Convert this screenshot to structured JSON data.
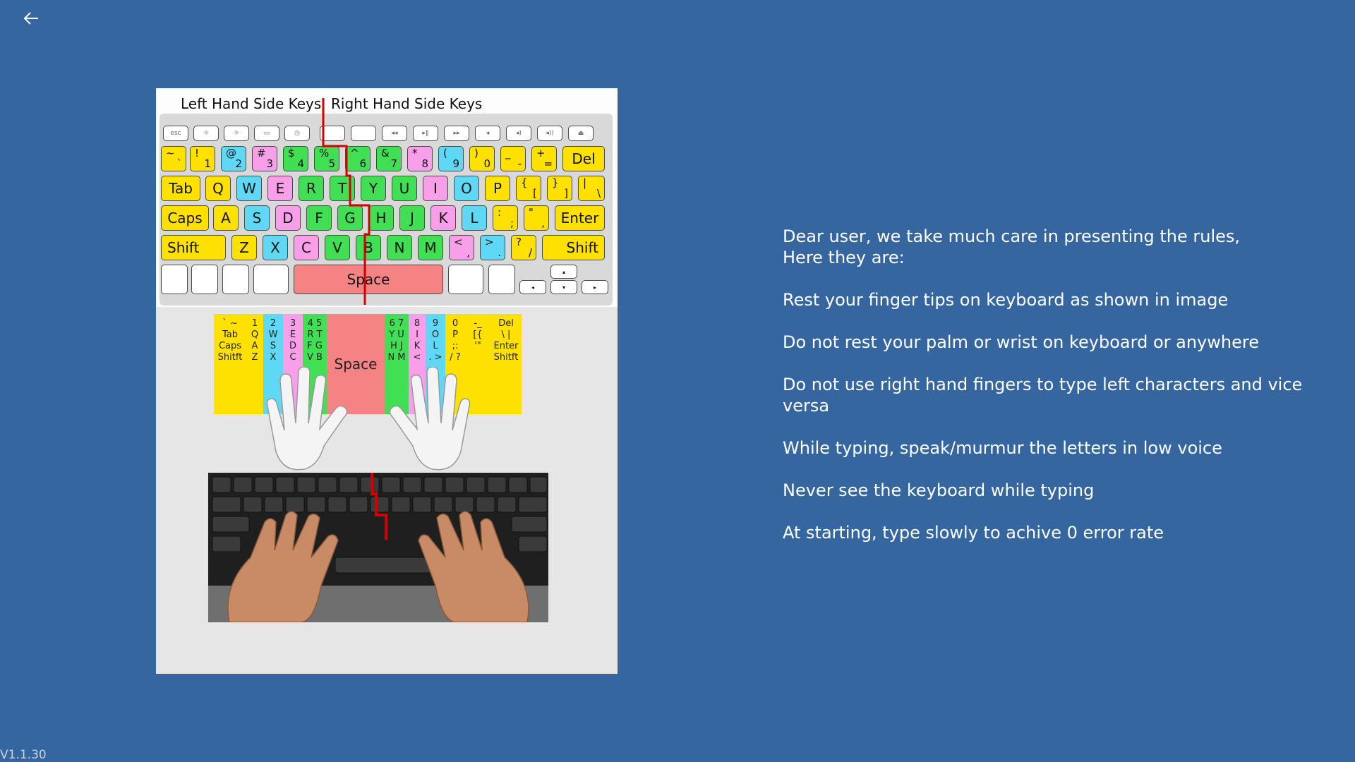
{
  "nav": {
    "back_icon": "arrow-left-icon"
  },
  "version": "V1.1.30",
  "illustration": {
    "left_caption": "Left Hand Side Keys",
    "right_caption": "Right Hand Side Keys",
    "colors": {
      "yellow": "#ffe100",
      "cyan": "#5fd8f5",
      "pink": "#f99ee9",
      "green": "#41df53",
      "red": "#f58383",
      "divider": "#d40000"
    },
    "keys": {
      "del": "Del",
      "tab": "Tab",
      "caps": "Caps",
      "enter": "Enter",
      "shift_left": "Shift",
      "shift_right": "Shift",
      "space": "Space",
      "q": "Q",
      "w": "W",
      "e": "E",
      "r": "R",
      "t": "T",
      "y": "Y",
      "u": "U",
      "i": "I",
      "o": "O",
      "p": "P",
      "a": "A",
      "s": "S",
      "d": "D",
      "f": "F",
      "g": "G",
      "h": "H",
      "j": "J",
      "k": "K",
      "l": "L",
      "z": "Z",
      "x": "X",
      "c": "C",
      "v": "V",
      "b": "B",
      "n": "N",
      "m": "M",
      "n1": "1",
      "n2": "2",
      "n3": "3",
      "n4": "4",
      "n5": "5",
      "n6": "6",
      "n7": "7",
      "n8": "8",
      "n9": "9",
      "n0": "0",
      "s1": "!",
      "s2": "@",
      "s3": "#",
      "s4": "$",
      "s5": "%",
      "s6": "^",
      "s7": "&",
      "s8": "*",
      "s9": "(",
      "s0": ")",
      "tilde": "~",
      "backtick": "`",
      "minus": "-",
      "underscore": "_",
      "equals": "=",
      "plus": "+",
      "lbrace": "{",
      "lbracket": "[",
      "rbrace": "}",
      "rbracket": "]",
      "pipe": "|",
      "backslash": "\\",
      "colon": ":",
      "semicolon": ";",
      "dquote": "\"",
      "squote": ",",
      "lt": "<",
      "comma": ",",
      "gt": ">",
      "period": ".",
      "question": "?",
      "slash": "/"
    },
    "finger_columns": [
      "` ~\nTab\nCaps\nShitft",
      "1\nQ\nA\nZ",
      "2\nW\nS\nX",
      "3\nE\nD\nC",
      "4 5\nR T\nF G\nV B",
      "6 7\nY U\nH J\nN M",
      "8\nI\nK\n<",
      "9\nO\nL\n. >",
      "0\nP\n;:\n/ ?",
      "-_\n[{\n'\"",
      "Del\n\\ |\nEnter\nShitft"
    ],
    "finger_space": "Space",
    "photo_desc": "hands-on-keyboard-photo"
  },
  "rules": {
    "intro_line1": "Dear user, we take much care in presenting the rules,",
    "intro_line2": "Here they are:",
    "items": [
      "Rest your finger tips on keyboard as shown in image",
      "Do not rest your palm or wrist on keyboard or anywhere",
      "Do not use right hand fingers to type left characters and vice versa",
      "While typing, speak/murmur the letters in low voice",
      "Never see the keyboard while typing",
      "At starting, type slowly to achive 0 error rate"
    ]
  }
}
